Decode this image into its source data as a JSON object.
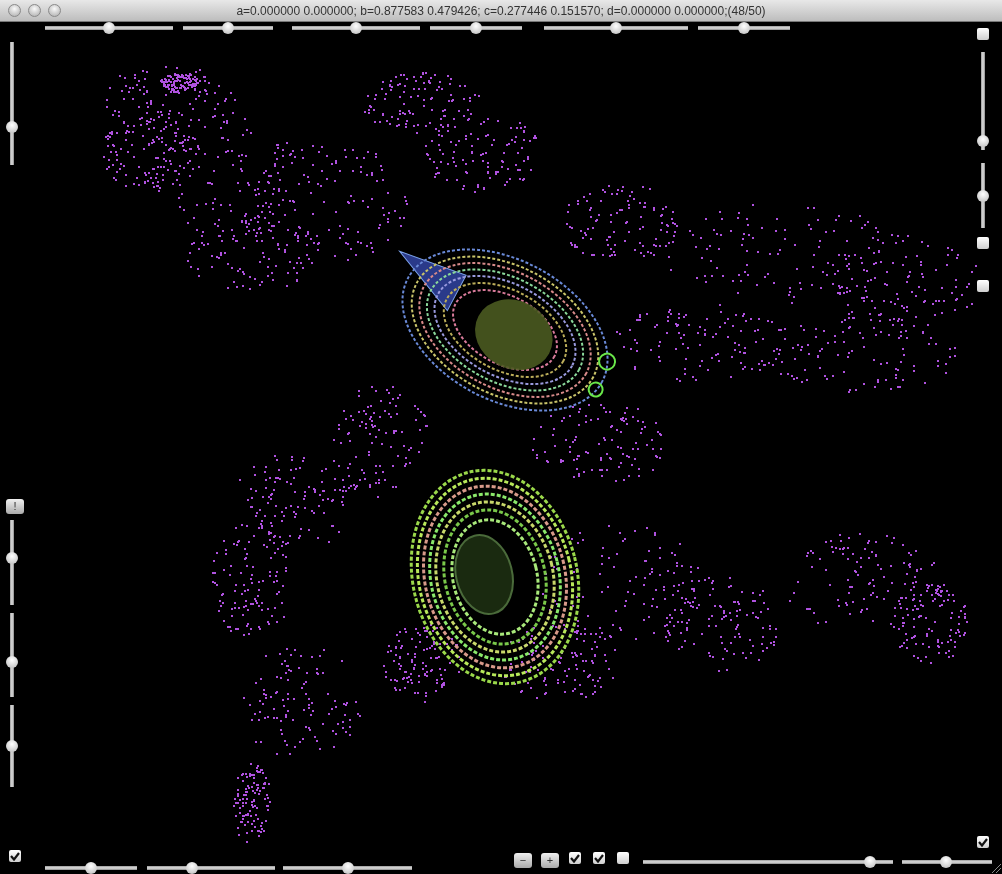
{
  "window": {
    "title": "a=0.000000 0.000000; b=0.877583 0.479426; c=0.277446 0.151570; d=0.000000 0.000000;(48/50)"
  },
  "top_controls": [
    {
      "kind": "slider",
      "level": 0.5
    },
    {
      "kind": "slider",
      "level": 0.5
    },
    {
      "kind": "slider",
      "level": 0.5
    },
    {
      "kind": "slider",
      "level": 0.5
    },
    {
      "kind": "slider",
      "level": 0.5
    },
    {
      "kind": "slider",
      "level": 0.5
    }
  ],
  "left_controls": [
    {
      "kind": "slider",
      "level": 0.29
    },
    {
      "kind": "button",
      "label": "!"
    },
    {
      "kind": "slider",
      "level": 0.56
    },
    {
      "kind": "slider",
      "level": 0.4
    },
    {
      "kind": "slider",
      "level": 0.5
    },
    {
      "kind": "checkbox",
      "checked": true
    }
  ],
  "right_controls": [
    {
      "kind": "checkbox",
      "checked": false
    },
    {
      "kind": "slider",
      "level": 0.03
    },
    {
      "kind": "slider",
      "level": 0.49
    },
    {
      "kind": "checkbox",
      "checked": false
    },
    {
      "kind": "checkbox",
      "checked": false
    },
    {
      "kind": "checkbox",
      "checked": true
    }
  ],
  "bottom_controls": [
    {
      "kind": "slider",
      "level": 0.5
    },
    {
      "kind": "slider",
      "level": 0.34
    },
    {
      "kind": "slider",
      "level": 0.5
    },
    {
      "kind": "button",
      "label": "−"
    },
    {
      "kind": "button",
      "label": "+"
    },
    {
      "kind": "checkbox",
      "checked": true
    },
    {
      "kind": "checkbox",
      "checked": true
    },
    {
      "kind": "checkbox",
      "checked": false
    },
    {
      "kind": "slider",
      "level": 0.93
    },
    {
      "kind": "slider",
      "level": 0.49
    }
  ]
}
